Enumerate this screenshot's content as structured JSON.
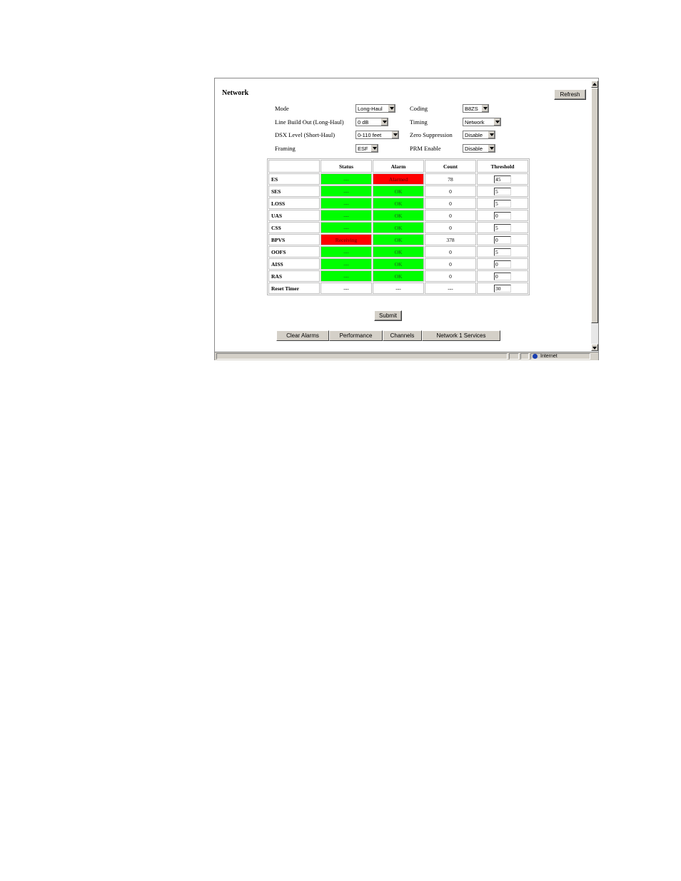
{
  "page": {
    "title": "Network",
    "refresh_label": "Refresh",
    "submit_label": "Submit"
  },
  "settings": {
    "mode": {
      "label": "Mode",
      "value": "Long-Haul"
    },
    "lbo": {
      "label": "Line Build Out (Long-Haul)",
      "value": "0 dB"
    },
    "dsx": {
      "label": "DSX Level (Short-Haul)",
      "value": "0-110 feet"
    },
    "framing": {
      "label": "Framing",
      "value": "ESF"
    },
    "coding": {
      "label": "Coding",
      "value": "B8ZS"
    },
    "timing": {
      "label": "Timing",
      "value": "Network"
    },
    "zero_suppression": {
      "label": "Zero Suppression",
      "value": "Disable"
    },
    "prm_enable": {
      "label": "PRM Enable",
      "value": "Disable"
    }
  },
  "table": {
    "headers": [
      "Status",
      "Alarm",
      "Count",
      "Threshold"
    ],
    "rows": [
      {
        "label": "ES",
        "status": "---",
        "alarm": "Alarmed",
        "count": "78",
        "threshold": "45"
      },
      {
        "label": "SES",
        "status": "---",
        "alarm": "OK",
        "count": "0",
        "threshold": "5"
      },
      {
        "label": "LOSS",
        "status": "---",
        "alarm": "OK",
        "count": "0",
        "threshold": "5"
      },
      {
        "label": "UAS",
        "status": "---",
        "alarm": "OK",
        "count": "0",
        "threshold": "0"
      },
      {
        "label": "CSS",
        "status": "---",
        "alarm": "OK",
        "count": "0",
        "threshold": "5"
      },
      {
        "label": "BPVS",
        "status": "Receiving",
        "alarm": "OK",
        "count": "378",
        "threshold": "0"
      },
      {
        "label": "OOFS",
        "status": "---",
        "alarm": "OK",
        "count": "0",
        "threshold": "5"
      },
      {
        "label": "AISS",
        "status": "---",
        "alarm": "OK",
        "count": "0",
        "threshold": "0"
      },
      {
        "label": "RAS",
        "status": "---",
        "alarm": "OK",
        "count": "0",
        "threshold": "0"
      }
    ],
    "reset": {
      "label": "Reset Timer",
      "status": "---",
      "alarm": "---",
      "count": "---",
      "threshold": "30"
    }
  },
  "tabs": [
    "Clear Alarms",
    "Performance",
    "Channels",
    "Network 1 Services"
  ],
  "statusbar": {
    "zone": "Internet"
  },
  "colors": {
    "ok": "#00ff00",
    "alarm": "#ff0000"
  }
}
